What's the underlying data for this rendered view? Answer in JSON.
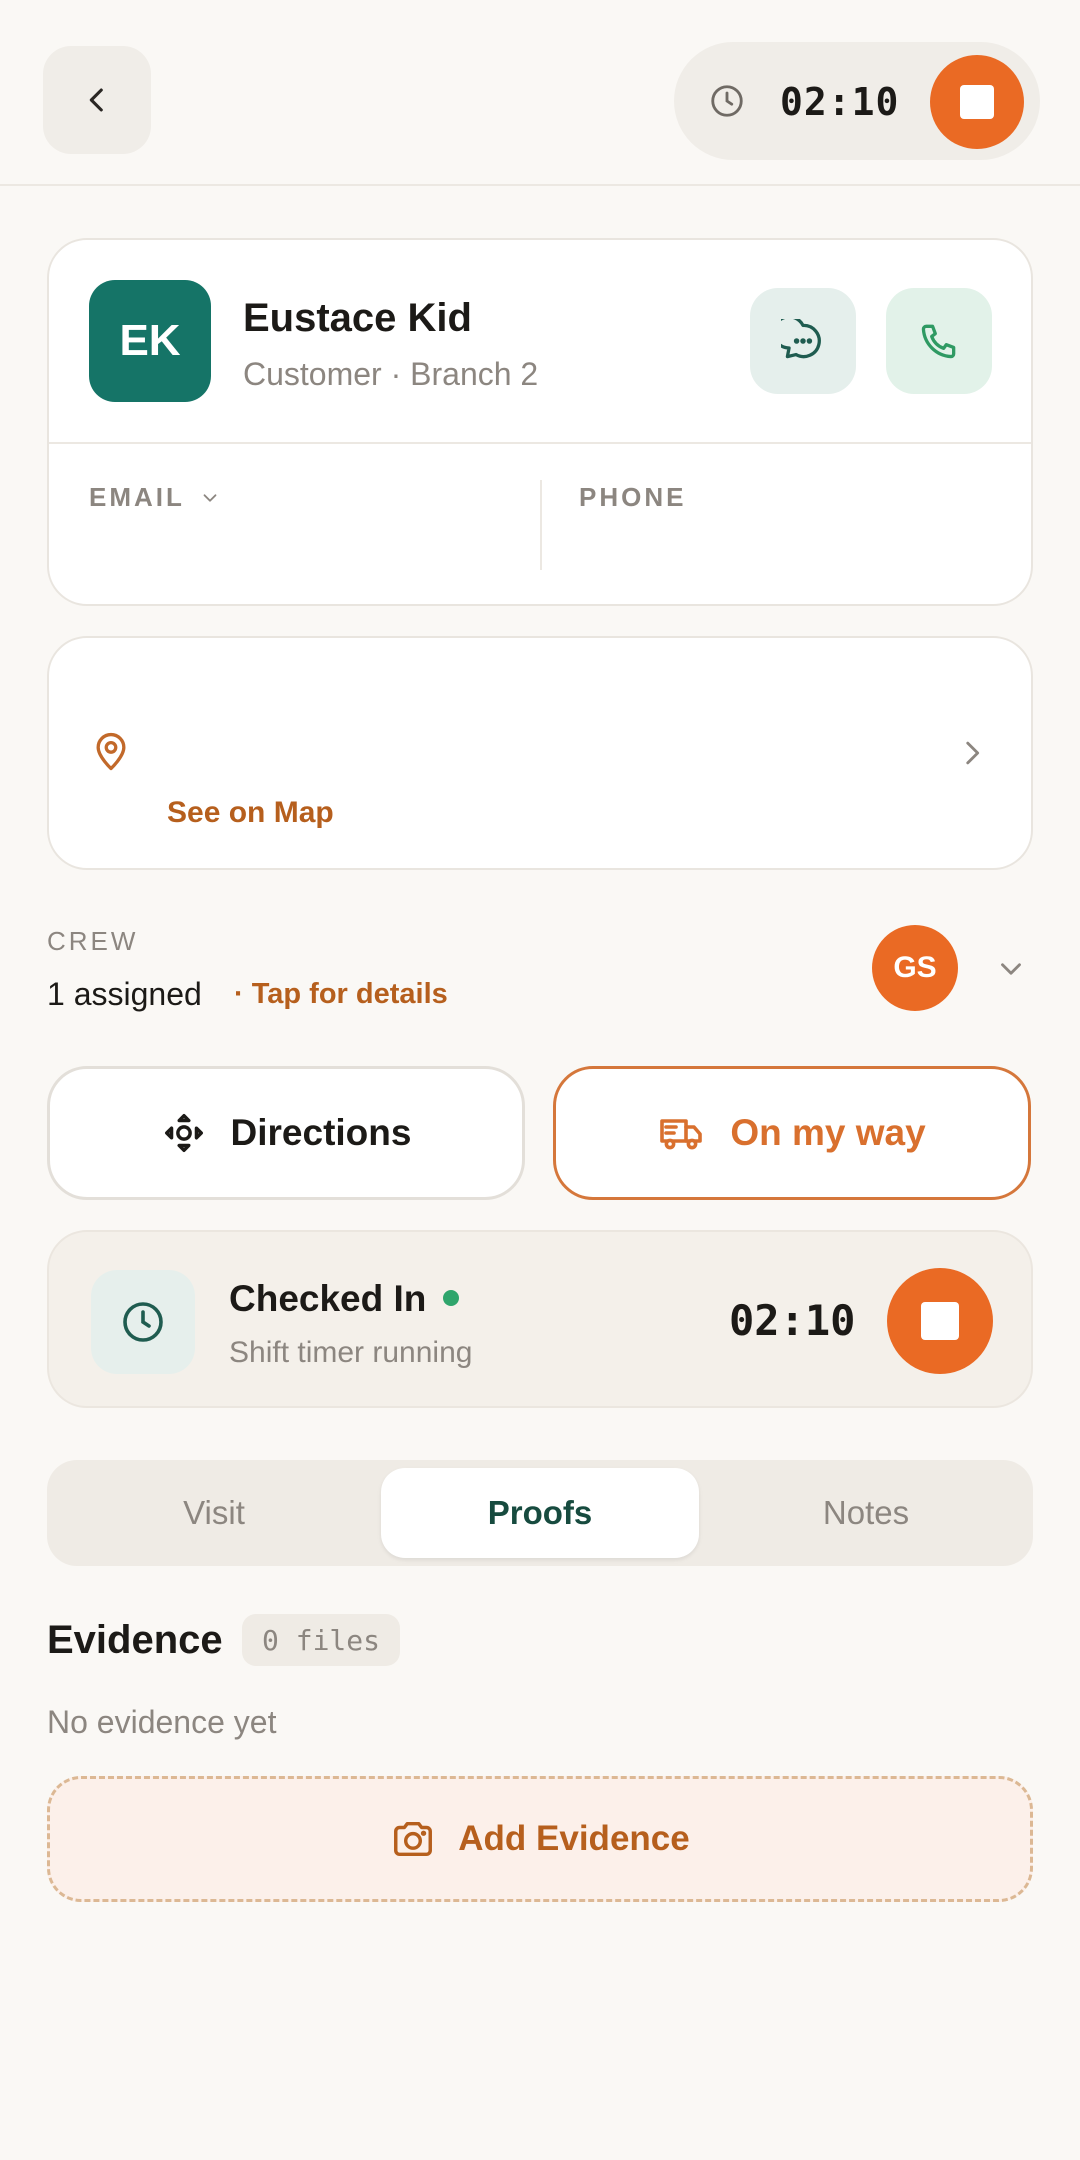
{
  "header": {
    "timer": "02:10"
  },
  "contact": {
    "initials": "EK",
    "name": "Eustace Kid",
    "subtitle": "Customer · Branch 2",
    "email_label": "EMAIL",
    "phone_label": "PHONE"
  },
  "address": {
    "map_link": "See on Map"
  },
  "crew": {
    "label": "CREW",
    "count": "1 assigned",
    "details_link": "· Tap for details",
    "avatar_initials": "GS"
  },
  "actions": {
    "directions": "Directions",
    "on_my_way": "On my way"
  },
  "checkin": {
    "title": "Checked In",
    "subtitle": "Shift timer running",
    "timer": "02:10"
  },
  "tabs": [
    {
      "label": "Visit",
      "active": false
    },
    {
      "label": "Proofs",
      "active": true
    },
    {
      "label": "Notes",
      "active": false
    }
  ],
  "evidence": {
    "title": "Evidence",
    "count_badge": "0 files",
    "empty_text": "No evidence yet",
    "add_button": "Add Evidence"
  },
  "colors": {
    "accent_orange": "#ea6a24",
    "brand_teal": "#157467",
    "link_brown": "#b65f1d",
    "status_green": "#2fa56c"
  },
  "icons": {
    "back": "chevron-left-icon",
    "timer": "clock-icon",
    "stop": "stop-icon",
    "message": "message-icon",
    "call": "phone-icon",
    "location": "map-pin-icon",
    "directions": "directions-icon",
    "on_my_way": "truck-icon",
    "camera": "camera-icon"
  }
}
